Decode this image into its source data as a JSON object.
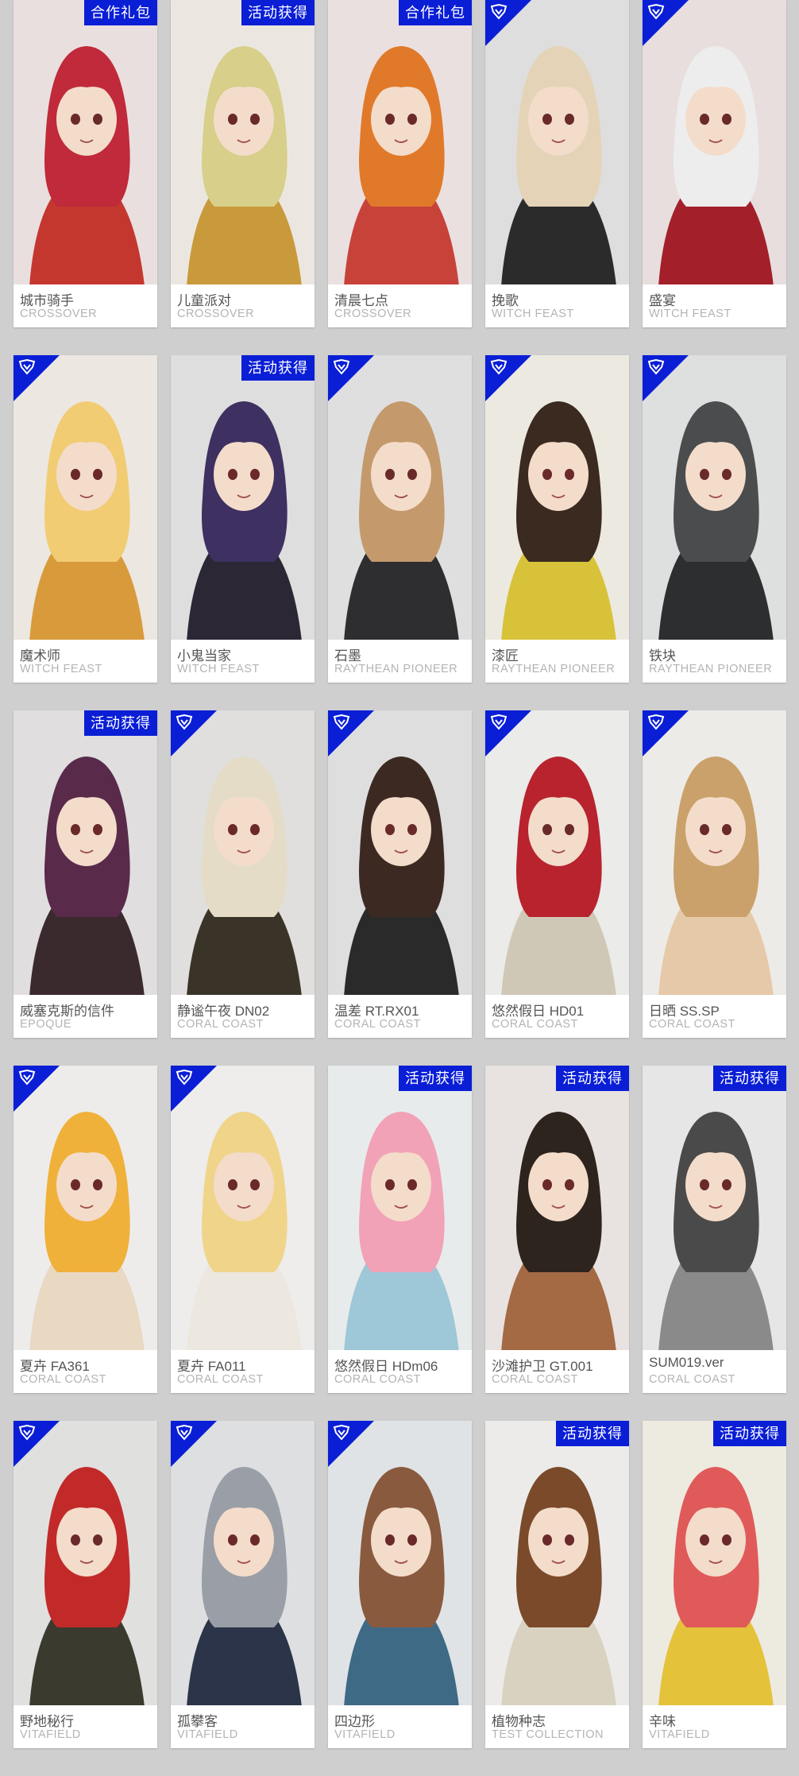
{
  "colors": {
    "badge": "#0a1ed6",
    "background": "#cfcfcf"
  },
  "cards": [
    {
      "name": "城市骑手",
      "series": "CROSSOVER",
      "badge": "合作礼包",
      "corner": false,
      "tone": "#c4372f",
      "hair": "#c02a3a"
    },
    {
      "name": "儿童派对",
      "series": "CROSSOVER",
      "badge": "活动获得",
      "corner": false,
      "tone": "#c99a3b",
      "hair": "#d7cf8a"
    },
    {
      "name": "清晨七点",
      "series": "CROSSOVER",
      "badge": "合作礼包",
      "corner": false,
      "tone": "#c7433a",
      "hair": "#e07a2a"
    },
    {
      "name": "挽歌",
      "series": "WITCH FEAST",
      "badge": "",
      "corner": true,
      "tone": "#2b2b2b",
      "hair": "#e4d3b6"
    },
    {
      "name": "盛宴",
      "series": "WITCH FEAST",
      "badge": "",
      "corner": true,
      "tone": "#a3202a",
      "hair": "#ededed"
    },
    {
      "name": "魔术师",
      "series": "WITCH FEAST",
      "badge": "",
      "corner": true,
      "tone": "#d89a3b",
      "hair": "#f1cc72"
    },
    {
      "name": "小鬼当家",
      "series": "WITCH FEAST",
      "badge": "活动获得",
      "corner": false,
      "tone": "#2b2735",
      "hair": "#3e3060"
    },
    {
      "name": "石墨",
      "series": "RAYTHEAN PIONEER",
      "badge": "",
      "corner": true,
      "tone": "#2e2e30",
      "hair": "#c49a6c"
    },
    {
      "name": "漆匠",
      "series": "RAYTHEAN PIONEER",
      "badge": "",
      "corner": true,
      "tone": "#d8c23a",
      "hair": "#3a2a20"
    },
    {
      "name": "铁块",
      "series": "RAYTHEAN PIONEER",
      "badge": "",
      "corner": true,
      "tone": "#2c2e30",
      "hair": "#4a4c4e"
    },
    {
      "name": "威塞克斯的信件",
      "series": "EPOQUE",
      "badge": "活动获得",
      "corner": false,
      "tone": "#3a2a2e",
      "hair": "#5a2a4a"
    },
    {
      "name": "静谧午夜 DN02",
      "series": "CORAL COAST",
      "badge": "",
      "corner": true,
      "tone": "#3a3328",
      "hair": "#e4dcc6"
    },
    {
      "name": "温差 RT.RX01",
      "series": "CORAL COAST",
      "badge": "",
      "corner": true,
      "tone": "#2a2a2a",
      "hair": "#3c2a22"
    },
    {
      "name": "悠然假日 HD01",
      "series": "CORAL COAST",
      "badge": "",
      "corner": true,
      "tone": "#d0c8b6",
      "hair": "#b8232e"
    },
    {
      "name": "日晒 SS.SP",
      "series": "CORAL COAST",
      "badge": "",
      "corner": true,
      "tone": "#e6c9a8",
      "hair": "#caa16a"
    },
    {
      "name": "夏卉 FA361",
      "series": "CORAL COAST",
      "badge": "",
      "corner": true,
      "tone": "#e9d8c2",
      "hair": "#f0b13a"
    },
    {
      "name": "夏卉 FA011",
      "series": "CORAL COAST",
      "badge": "",
      "corner": true,
      "tone": "#ece7df",
      "hair": "#efd48a"
    },
    {
      "name": "悠然假日 HDm06",
      "series": "CORAL COAST",
      "badge": "活动获得",
      "corner": false,
      "tone": "#9ec7d8",
      "hair": "#f2a2b6"
    },
    {
      "name": "沙滩护卫 GT.001",
      "series": "CORAL COAST",
      "badge": "活动获得",
      "corner": false,
      "tone": "#a46a44",
      "hair": "#2e241e"
    },
    {
      "name": "SUM019.ver",
      "series": "CORAL COAST",
      "badge": "活动获得",
      "corner": false,
      "tone": "#8a8a8a",
      "hair": "#4a4a4a"
    },
    {
      "name": "野地秘行",
      "series": "VITAFIELD",
      "badge": "",
      "corner": true,
      "tone": "#3a3a2e",
      "hair": "#c22a2a"
    },
    {
      "name": "孤攀客",
      "series": "VITAFIELD",
      "badge": "",
      "corner": true,
      "tone": "#2b3448",
      "hair": "#9a9ea6"
    },
    {
      "name": "四边形",
      "series": "VITAFIELD",
      "badge": "",
      "corner": true,
      "tone": "#3e6a86",
      "hair": "#8a5a3e"
    },
    {
      "name": "植物种志",
      "series": "TEST COLLECTION",
      "badge": "活动获得",
      "corner": false,
      "tone": "#d9d2c0",
      "hair": "#7a4a2a"
    },
    {
      "name": "辛味",
      "series": "VITAFIELD",
      "badge": "活动获得",
      "corner": false,
      "tone": "#e4c23a",
      "hair": "#e05a5a"
    }
  ]
}
